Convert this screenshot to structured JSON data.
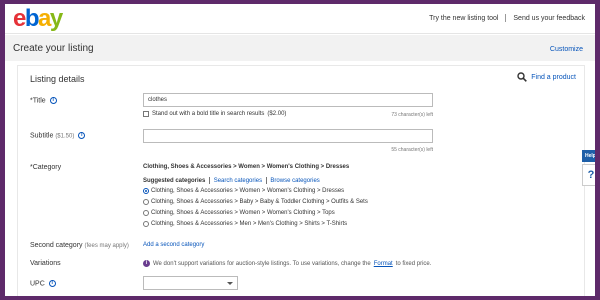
{
  "logo": {
    "letters": [
      "e",
      "b",
      "a",
      "y"
    ],
    "colors": [
      "#e53238",
      "#0064d2",
      "#f5af02",
      "#86b817"
    ]
  },
  "topbar": {
    "try_new_tool": "Try the new listing tool",
    "feedback": "Send us your feedback"
  },
  "header": {
    "title": "Create your listing",
    "customize": "Customize"
  },
  "listing_details": {
    "section_title": "Listing details",
    "find_product": "Find a product",
    "title_field": {
      "label": "*Title",
      "value": "clothes",
      "bold_option": "Stand out with a bold title in search results",
      "bold_price": "($2.00)",
      "chars_left": "73 character(s) left"
    },
    "subtitle_field": {
      "label": "Subtitle",
      "price": "($1.50)",
      "value": "",
      "chars_left": "55 character(s) left"
    },
    "category": {
      "label": "*Category",
      "current": "Clothing, Shoes & Accessories > Women > Women's Clothing > Dresses",
      "suggested_label": "Suggested categories",
      "search_link": "Search categories",
      "browse_link": "Browse categories",
      "options": [
        {
          "text": "Clothing, Shoes & Accessories > Women > Women's Clothing > Dresses",
          "selected": true
        },
        {
          "text": "Clothing, Shoes & Accessories > Baby > Baby & Toddler Clothing > Outfits & Sets",
          "selected": false
        },
        {
          "text": "Clothing, Shoes & Accessories > Women > Women's Clothing > Tops",
          "selected": false
        },
        {
          "text": "Clothing, Shoes & Accessories > Men > Men's Clothing > Shirts > T-Shirts",
          "selected": false
        }
      ]
    },
    "second_category": {
      "label": "Second category",
      "note": "(fees may apply)",
      "link": "Add a second category"
    },
    "variations": {
      "label": "Variations",
      "note_before": "We don't support variations for auction-style listings. To use variations, change the",
      "note_link": "Format",
      "note_after": "to fixed price."
    },
    "upc": {
      "label": "UPC",
      "value": ""
    }
  },
  "help": {
    "tab_label": "Help",
    "icon": "?"
  }
}
